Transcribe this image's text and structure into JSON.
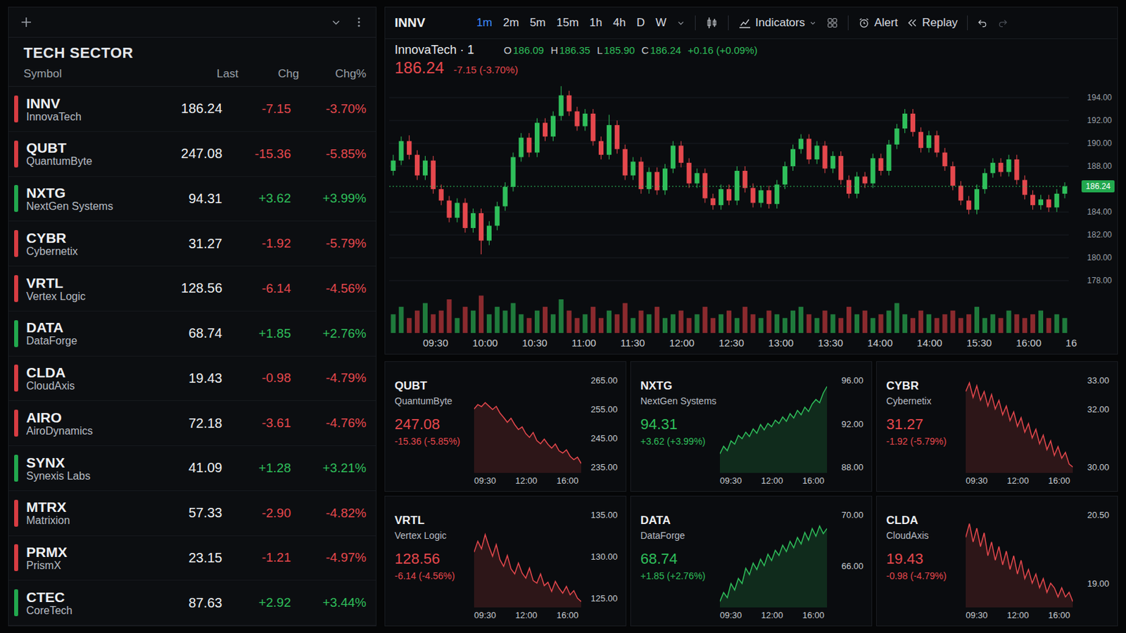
{
  "watchlist": {
    "title": "TECH SECTOR",
    "columns": [
      "Symbol",
      "Last",
      "Chg",
      "Chg%"
    ],
    "rows": [
      {
        "symbol": "INNV",
        "name": "InnovaTech",
        "last": "186.24",
        "chg": "-7.15",
        "chgPct": "-3.70%",
        "up": false
      },
      {
        "symbol": "QUBT",
        "name": "QuantumByte",
        "last": "247.08",
        "chg": "-15.36",
        "chgPct": "-5.85%",
        "up": false
      },
      {
        "symbol": "NXTG",
        "name": "NextGen Systems",
        "last": "94.31",
        "chg": "+3.62",
        "chgPct": "+3.99%",
        "up": true
      },
      {
        "symbol": "CYBR",
        "name": "Cybernetix",
        "last": "31.27",
        "chg": "-1.92",
        "chgPct": "-5.79%",
        "up": false
      },
      {
        "symbol": "VRTL",
        "name": "Vertex Logic",
        "last": "128.56",
        "chg": "-6.14",
        "chgPct": "-4.56%",
        "up": false
      },
      {
        "symbol": "DATA",
        "name": "DataForge",
        "last": "68.74",
        "chg": "+1.85",
        "chgPct": "+2.76%",
        "up": true
      },
      {
        "symbol": "CLDA",
        "name": "CloudAxis",
        "last": "19.43",
        "chg": "-0.98",
        "chgPct": "-4.79%",
        "up": false
      },
      {
        "symbol": "AIRO",
        "name": "AiroDynamics",
        "last": "72.18",
        "chg": "-3.61",
        "chgPct": "-4.76%",
        "up": false
      },
      {
        "symbol": "SYNX",
        "name": "Synexis Labs",
        "last": "41.09",
        "chg": "+1.28",
        "chgPct": "+3.21%",
        "up": true
      },
      {
        "symbol": "MTRX",
        "name": "Matrixion",
        "last": "57.33",
        "chg": "-2.90",
        "chgPct": "-4.82%",
        "up": false
      },
      {
        "symbol": "PRMX",
        "name": "PrismX",
        "last": "23.15",
        "chg": "-1.21",
        "chgPct": "-4.97%",
        "up": false
      },
      {
        "symbol": "CTEC",
        "name": "CoreTech",
        "last": "87.63",
        "chg": "+2.92",
        "chgPct": "+3.44%",
        "up": true
      }
    ]
  },
  "mainChart": {
    "symbol": "INNV",
    "timeframes": [
      {
        "label": "1m",
        "selected": true
      },
      {
        "label": "2m",
        "selected": false
      },
      {
        "label": "5m",
        "selected": false
      },
      {
        "label": "15m",
        "selected": false
      },
      {
        "label": "1h",
        "selected": false
      },
      {
        "label": "4h",
        "selected": false
      },
      {
        "label": "D",
        "selected": false
      },
      {
        "label": "W",
        "selected": false
      }
    ],
    "tools": {
      "indicators": "Indicators",
      "alert": "Alert",
      "replay": "Replay"
    },
    "title": "InnovaTech · 1",
    "price": "186.24",
    "change": "-7.15 (-3.70%)",
    "up": false,
    "ohlc": [
      {
        "label": "O",
        "value": "186.09"
      },
      {
        "label": "H",
        "value": "186.35"
      },
      {
        "label": "L",
        "value": "185.90"
      },
      {
        "label": "C",
        "value": "186.24"
      }
    ],
    "ohlcChange": "+0.16 (+0.09%)",
    "lastCandleUp": true,
    "priceLabel": "186.24",
    "yTicks": [
      "194.00",
      "192.00",
      "190.00",
      "188.00",
      "184.00",
      "182.00",
      "180.00",
      "178.00"
    ],
    "xTicks": [
      "09:30",
      "10:00",
      "10:30",
      "11:00",
      "11:30",
      "12:00",
      "12:30",
      "13:00",
      "13:30",
      "14:00",
      "14:00",
      "15:30",
      "16:00",
      "16"
    ],
    "firstOpen": 187.6,
    "close": [
      188.5,
      190.2,
      189.0,
      187.2,
      188.5,
      186.0,
      185.0,
      183.5,
      184.8,
      182.6,
      183.9,
      181.5,
      182.8,
      184.5,
      186.2,
      188.8,
      190.5,
      189.2,
      191.8,
      190.6,
      192.4,
      194.2,
      192.8,
      191.5,
      192.6,
      190.2,
      189.0,
      191.6,
      189.5,
      187.2,
      188.4,
      186.0,
      187.5,
      185.9,
      187.8,
      189.8,
      188.3,
      186.5,
      187.4,
      185.2,
      184.6,
      186.0,
      185.0,
      187.6,
      186.1,
      184.8,
      185.9,
      184.7,
      186.4,
      188.0,
      189.5,
      190.4,
      188.6,
      189.8,
      187.8,
      188.9,
      186.8,
      185.6,
      187.1,
      186.5,
      188.7,
      187.6,
      189.9,
      191.3,
      192.6,
      191.0,
      189.6,
      190.7,
      189.2,
      188.0,
      186.3,
      185.0,
      184.2,
      186.0,
      187.4,
      188.3,
      187.5,
      188.6,
      186.8,
      185.5,
      184.6,
      185.1,
      184.4,
      185.6,
      186.24
    ],
    "high": [
      189.0,
      190.6,
      190.7,
      189.4,
      188.9,
      188.9,
      186.4,
      185.4,
      185.2,
      185.2,
      184.3,
      184.3,
      183.2,
      184.9,
      186.6,
      189.2,
      190.9,
      190.9,
      192.2,
      192.2,
      192.8,
      195.0,
      194.6,
      193.2,
      193.0,
      193.0,
      190.6,
      192.5,
      192.0,
      189.9,
      188.8,
      188.8,
      187.9,
      187.9,
      188.2,
      190.2,
      190.2,
      188.7,
      187.8,
      187.8,
      185.6,
      186.4,
      186.4,
      188.0,
      188.0,
      186.5,
      186.3,
      186.3,
      186.8,
      188.4,
      189.9,
      190.8,
      190.8,
      190.2,
      190.2,
      189.3,
      189.3,
      187.2,
      187.5,
      187.5,
      189.1,
      189.1,
      190.3,
      191.7,
      193.0,
      193.0,
      191.4,
      191.1,
      191.1,
      189.6,
      188.4,
      186.7,
      185.4,
      186.4,
      187.8,
      188.7,
      188.7,
      189.0,
      189.0,
      187.2,
      185.9,
      185.5,
      185.5,
      186.0,
      186.6
    ],
    "low": [
      187.2,
      188.1,
      188.6,
      186.8,
      186.8,
      185.6,
      184.6,
      183.1,
      183.1,
      182.2,
      182.2,
      180.3,
      181.1,
      182.4,
      184.1,
      185.8,
      188.4,
      188.8,
      188.8,
      190.2,
      190.2,
      192.0,
      192.4,
      191.1,
      191.1,
      189.8,
      188.6,
      188.6,
      189.1,
      186.8,
      186.8,
      185.6,
      185.6,
      185.5,
      185.5,
      187.4,
      187.9,
      186.1,
      186.1,
      184.8,
      184.2,
      184.2,
      184.6,
      184.6,
      185.7,
      184.4,
      184.4,
      184.3,
      184.3,
      186.0,
      187.6,
      189.1,
      188.2,
      188.2,
      187.4,
      187.4,
      186.4,
      185.2,
      185.2,
      186.1,
      186.1,
      187.2,
      187.2,
      189.5,
      190.9,
      190.6,
      189.2,
      189.2,
      188.8,
      187.6,
      185.9,
      184.6,
      183.8,
      183.8,
      185.6,
      187.0,
      187.1,
      187.1,
      186.4,
      185.1,
      184.2,
      184.2,
      184.0,
      184.0,
      185.2
    ],
    "volume": [
      5,
      7,
      4,
      6,
      8,
      5,
      6,
      9,
      4,
      7,
      6,
      10,
      5,
      7,
      6,
      8,
      5,
      4,
      6,
      7,
      5,
      9,
      6,
      4,
      5,
      7,
      4,
      6,
      5,
      8,
      4,
      6,
      5,
      7,
      4,
      5,
      6,
      4,
      5,
      7,
      4,
      5,
      6,
      4,
      7,
      5,
      4,
      6,
      5,
      4,
      6,
      7,
      5,
      4,
      6,
      5,
      4,
      7,
      5,
      6,
      4,
      5,
      6,
      8,
      5,
      4,
      6,
      5,
      4,
      5,
      6,
      4,
      5,
      7,
      4,
      5,
      4,
      6,
      5,
      4,
      5,
      6,
      4,
      5,
      4
    ]
  },
  "miniCharts": [
    {
      "symbol": "QUBT",
      "name": "QuantumByte",
      "price": "247.08",
      "change": "-15.36 (-5.85%)",
      "up": false,
      "yTicks": [
        "265.00",
        "255.00",
        "245.00",
        "235.00"
      ],
      "xTicks": [
        "09:30",
        "12:00",
        "16:00"
      ],
      "series": [
        255.0,
        256.5,
        255.8,
        257.2,
        256.0,
        254.8,
        255.9,
        253.6,
        252.1,
        250.4,
        251.8,
        249.6,
        247.9,
        248.8,
        246.5,
        245.2,
        246.9,
        244.1,
        243.0,
        244.6,
        242.8,
        241.5,
        242.9,
        240.6,
        239.8,
        240.9,
        238.7,
        237.5,
        238.4,
        236.2
      ]
    },
    {
      "symbol": "NXTG",
      "name": "NextGen Systems",
      "price": "94.31",
      "change": "+3.62 (+3.99%)",
      "up": true,
      "yTicks": [
        "96.00",
        "92.00",
        "88.00"
      ],
      "xTicks": [
        "09:30",
        "12:00",
        "16:00"
      ],
      "series": [
        89.2,
        89.9,
        89.5,
        90.4,
        90.1,
        90.9,
        90.6,
        91.2,
        90.8,
        91.5,
        91.1,
        91.9,
        91.4,
        92.0,
        91.7,
        92.3,
        92.0,
        92.6,
        92.2,
        92.9,
        92.5,
        93.2,
        92.8,
        93.5,
        93.1,
        93.8,
        94.2,
        93.9,
        94.8,
        95.4
      ]
    },
    {
      "symbol": "CYBR",
      "name": "Cybernetix",
      "price": "31.27",
      "change": "-1.92 (-5.79%)",
      "up": false,
      "yTicks": [
        "33.00",
        "32.00",
        "30.00"
      ],
      "xTicks": [
        "09:30",
        "12:00",
        "16:00"
      ],
      "series": [
        32.6,
        32.9,
        32.4,
        32.8,
        32.3,
        32.6,
        32.1,
        32.5,
        32.0,
        32.3,
        31.8,
        32.1,
        31.6,
        31.9,
        31.4,
        31.7,
        31.2,
        31.5,
        31.0,
        31.3,
        30.8,
        31.1,
        30.6,
        30.9,
        30.4,
        30.7,
        30.3,
        30.5,
        30.1,
        30.0
      ]
    },
    {
      "symbol": "VRTL",
      "name": "Vertex Logic",
      "price": "128.56",
      "change": "-6.14 (-4.56%)",
      "up": false,
      "yTicks": [
        "135.00",
        "130.00",
        "125.00"
      ],
      "xTicks": [
        "09:30",
        "12:00",
        "16:00"
      ],
      "series": [
        130.5,
        131.8,
        130.9,
        132.6,
        131.2,
        130.0,
        131.4,
        129.6,
        128.8,
        130.1,
        128.5,
        127.9,
        129.2,
        128.0,
        127.4,
        128.6,
        127.1,
        126.8,
        127.9,
        126.5,
        126.9,
        125.8,
        127.0,
        126.2,
        125.6,
        126.4,
        125.4,
        125.9,
        125.0,
        124.6
      ]
    },
    {
      "symbol": "DATA",
      "name": "DataForge",
      "price": "68.74",
      "change": "+1.85 (+2.76%)",
      "up": true,
      "yTicks": [
        "70.00",
        "66.00"
      ],
      "xTicks": [
        "09:30",
        "12:00",
        "16:00"
      ],
      "series": [
        63.2,
        63.9,
        63.5,
        64.6,
        64.1,
        65.0,
        64.6,
        65.8,
        65.3,
        66.2,
        65.7,
        66.5,
        66.0,
        66.9,
        66.4,
        67.2,
        66.8,
        67.6,
        67.1,
        67.9,
        67.4,
        68.2,
        67.7,
        68.6,
        68.0,
        68.9,
        68.3,
        69.1,
        68.5,
        68.9
      ]
    },
    {
      "symbol": "CLDA",
      "name": "CloudAxis",
      "price": "19.43",
      "change": "-0.98 (-4.79%)",
      "up": false,
      "yTicks": [
        "20.50",
        "19.00"
      ],
      "xTicks": [
        "09:30",
        "12:00",
        "16:00"
      ],
      "series": [
        20.0,
        20.3,
        19.9,
        20.2,
        19.8,
        20.1,
        19.6,
        19.9,
        19.5,
        19.8,
        19.4,
        19.7,
        19.3,
        19.6,
        19.2,
        19.5,
        19.1,
        19.3,
        19.0,
        19.2,
        18.9,
        19.1,
        18.8,
        19.0,
        18.9,
        18.7,
        18.9,
        18.7,
        18.8,
        18.6
      ]
    }
  ]
}
